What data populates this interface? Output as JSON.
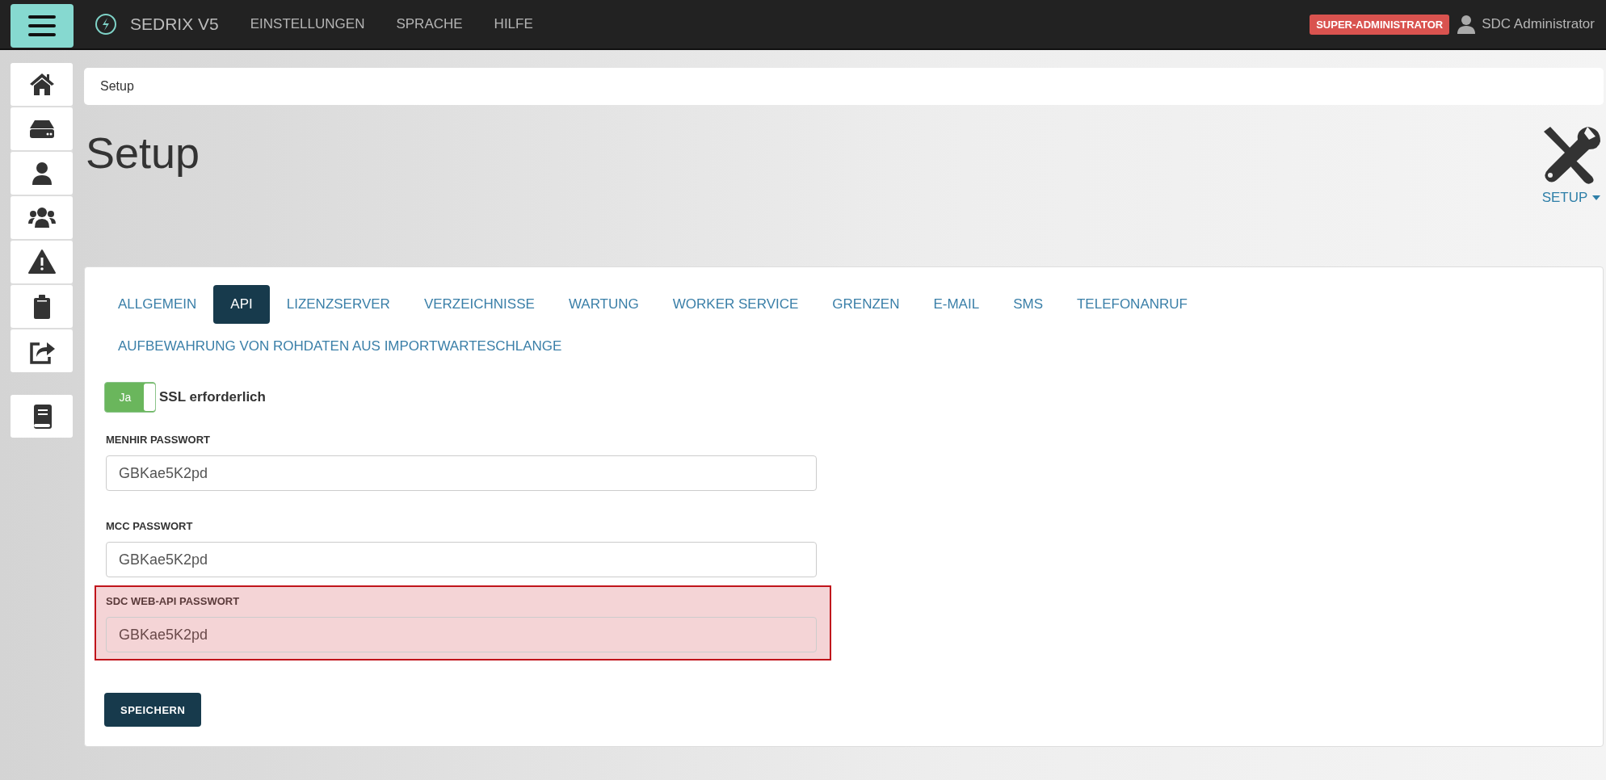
{
  "topbar": {
    "brand": "SEDRIX V5",
    "menu": [
      "EINSTELLUNGEN",
      "SPRACHE",
      "HILFE"
    ],
    "role_badge": "SUPER-ADMINISTRATOR",
    "user": "SDC Administrator"
  },
  "breadcrumb": "Setup",
  "page": {
    "title": "Setup",
    "setup_menu": "SETUP"
  },
  "tabs": [
    {
      "label": "ALLGEMEIN",
      "selected": false
    },
    {
      "label": "API",
      "selected": true
    },
    {
      "label": "LIZENZSERVER",
      "selected": false
    },
    {
      "label": "VERZEICHNISSE",
      "selected": false
    },
    {
      "label": "WARTUNG",
      "selected": false
    },
    {
      "label": "WORKER SERVICE",
      "selected": false
    },
    {
      "label": "GRENZEN",
      "selected": false
    },
    {
      "label": "E-MAIL",
      "selected": false
    },
    {
      "label": "SMS",
      "selected": false
    },
    {
      "label": "TELEFONANRUF",
      "selected": false
    },
    {
      "label": "AUFBEWAHRUNG VON ROHDATEN AUS IMPORTWARTESCHLANGE",
      "selected": false
    }
  ],
  "ssl_toggle": {
    "on": true,
    "state_label": "Ja",
    "label": "SSL erforderlich"
  },
  "fields": [
    {
      "label": "MENHIR PASSWORT",
      "value": "GBKae5K2pd",
      "error": false
    },
    {
      "label": "MCC PASSWORT",
      "value": "GBKae5K2pd",
      "error": false
    },
    {
      "label": "SDC WEB-API PASSWORT",
      "value": "GBKae5K2pd",
      "error": true
    }
  ],
  "save_button": "SPEICHERN"
}
